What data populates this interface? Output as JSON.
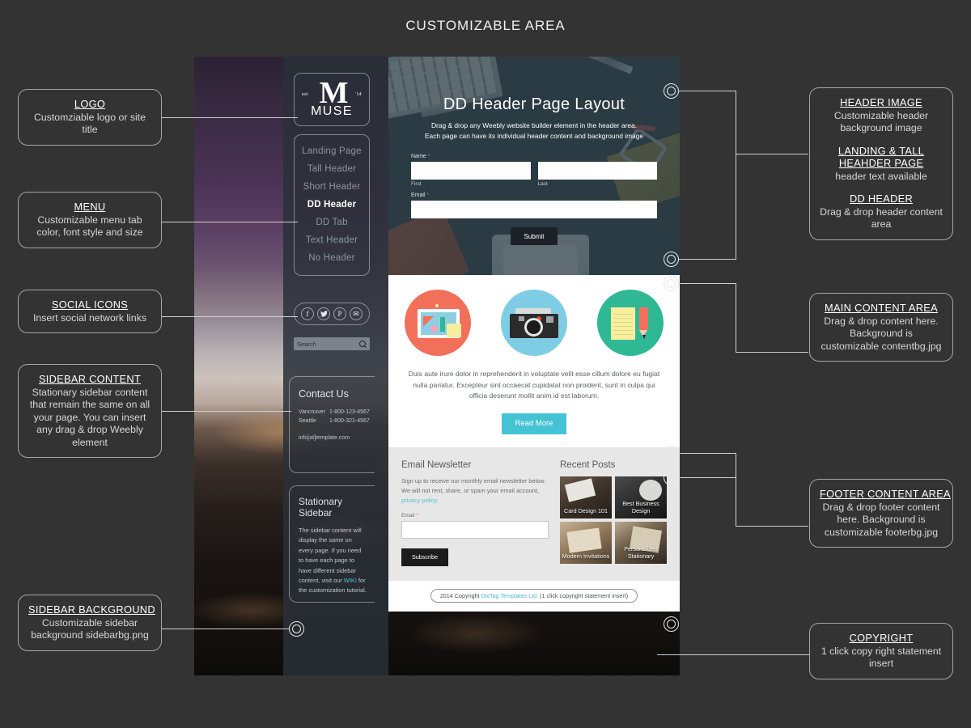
{
  "page": {
    "title": "CUSTOMIZABLE AREA"
  },
  "annotations": {
    "left": [
      {
        "id": "logo",
        "groups": [
          {
            "title": "LOGO",
            "body": "Customziable logo or site title"
          }
        ]
      },
      {
        "id": "menu",
        "groups": [
          {
            "title": "MENU",
            "body": "Customizable menu tab color, font style and size"
          }
        ]
      },
      {
        "id": "social-icons",
        "groups": [
          {
            "title": "SOCIAL ICONS",
            "body": "Insert social network links"
          }
        ]
      },
      {
        "id": "sidebar-content",
        "groups": [
          {
            "title": "SIDEBAR CONTENT",
            "body": "Stationary sidebar content that remain the same on all your page. You can insert any drag & drop Weebly element"
          }
        ]
      },
      {
        "id": "sidebar-background",
        "groups": [
          {
            "title": "SIDEBAR BACKGROUND",
            "body": "Customizable sidebar background sidebarbg.png"
          }
        ]
      }
    ],
    "right": [
      {
        "id": "header-image",
        "groups": [
          {
            "title": "HEADER IMAGE",
            "body": "Customizable header background image"
          },
          {
            "title": "LANDING & TALL HEAHDER PAGE",
            "body": "header text available"
          },
          {
            "title": "DD HEADER",
            "body": "Drag & drop header content area"
          }
        ]
      },
      {
        "id": "main-content-area",
        "groups": [
          {
            "title": "MAIN CONTENT AREA",
            "body": "Drag & drop content here. Background is customizable contentbg.jpg"
          }
        ]
      },
      {
        "id": "footer-content-area",
        "groups": [
          {
            "title": "FOOTER CONTENT AREA",
            "body": "Drag & drop footer content here. Background is customizable footerbg.jpg"
          }
        ]
      },
      {
        "id": "copyright",
        "groups": [
          {
            "title": "COPYRIGHT",
            "body": "1 click copy right statement insert"
          }
        ]
      }
    ]
  },
  "mockup": {
    "sidebar": {
      "logo": {
        "mark": "M",
        "est": "est",
        "year": "'14",
        "word": "MUSE"
      },
      "menu": [
        {
          "label": "Landing Page",
          "active": false
        },
        {
          "label": "Tall Header",
          "active": false
        },
        {
          "label": "Short Header",
          "active": false
        },
        {
          "label": "DD Header",
          "active": true
        },
        {
          "label": "DD Tab",
          "active": false
        },
        {
          "label": "Text Header",
          "active": false
        },
        {
          "label": "No Header",
          "active": false
        }
      ],
      "social": [
        {
          "name": "facebook-icon",
          "glyph": "f"
        },
        {
          "name": "twitter-icon",
          "glyph": "t"
        },
        {
          "name": "pinterest-icon",
          "glyph": "P"
        },
        {
          "name": "email-icon",
          "glyph": "✉"
        }
      ],
      "search": {
        "placeholder": "Search"
      },
      "contact": {
        "title": "Contact Us",
        "rows": [
          {
            "city": "Vancouver",
            "phone": "1-800-123-4567"
          },
          {
            "city": "Seattle",
            "phone": "1-800-321-4567"
          }
        ],
        "email": "info[at]template.com"
      },
      "stationary": {
        "title": "Stationary Sidebar",
        "text_before": "The sidebar content will display the same on every page. If you need to have each page to have different sidebar content, visit our ",
        "link": "WIKI",
        "text_after": " for the customization tutorial."
      }
    },
    "header": {
      "heading": "DD Header Page Layout",
      "sub_line1": "Drag & drop any Weebly website builder element in the header area.",
      "sub_line2": "Each page can have its individual header content and background image",
      "form": {
        "name_label": "Name",
        "required_mark": "*",
        "first_hint": "First",
        "last_hint": "Last",
        "email_label": "Email",
        "submit_label": "Submit"
      }
    },
    "main": {
      "icons": [
        {
          "name": "design-icon",
          "color": "#f2705a"
        },
        {
          "name": "camera-icon",
          "color": "#7fcde4"
        },
        {
          "name": "notepad-icon",
          "color": "#2eb894"
        }
      ],
      "paragraph": "Duis aute irure dolor in reprehenderit in voluptate velit esse cillum dolore eu fugiat nulla pariatur. Excepteur sint occaecat cupidatat non proident, sunt in culpa qui officia deserunt mollit anim id est laborum.",
      "read_more": "Read More"
    },
    "footer": {
      "newsletter": {
        "title": "Email Newsletter",
        "text_before": "Sign up to receive our monthly email newsletter below. We will not rent, share, or spam your email account, ",
        "link": "privacy policy.",
        "email_label": "Email",
        "required_mark": "*",
        "subscribe_label": "Subscribe"
      },
      "recent_posts": {
        "title": "Recent Posts",
        "items": [
          {
            "title": "Card Design 101"
          },
          {
            "title": "Best Business Design"
          },
          {
            "title": "Modern Invitations"
          },
          {
            "title": "Personalized Stationary"
          }
        ]
      }
    },
    "copyright": {
      "prefix": "2014 Copyright ",
      "link": "DivTag Templates Ltd.",
      "suffix": " (1 click copyright statement insert)"
    }
  },
  "colors": {
    "accent_teal": "#45c3d4",
    "coral": "#f2705a",
    "sky": "#7fcde4",
    "green": "#2eb894",
    "page_bg": "#333333"
  }
}
